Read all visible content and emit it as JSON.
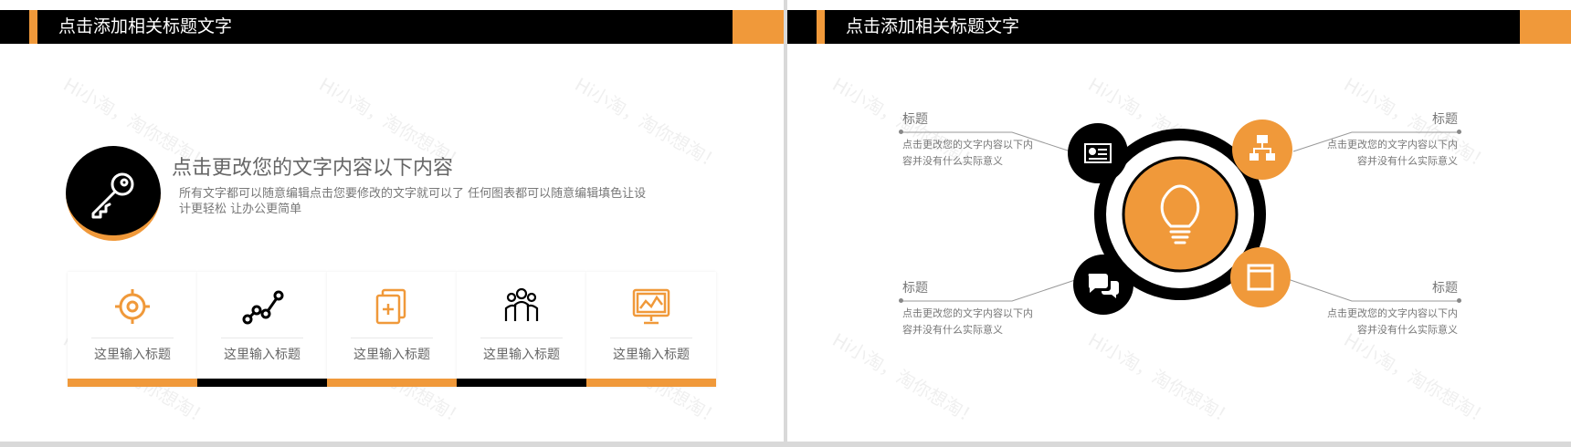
{
  "header_title": "点击添加相关标题文字",
  "watermark": "Hi小淘，淘你想淘！",
  "colors": {
    "accent": "#f0993a",
    "dark": "#000000",
    "text": "#666666"
  },
  "left_slide": {
    "heading": "点击更改您的文字内容以下内容",
    "description": "所有文字都可以随意编辑点击您要修改的文字就可以了 任何图表都可以随意编辑填色让设计更轻松 让办公更简单",
    "cards": [
      {
        "label": "这里输入标题",
        "icon": "target-icon",
        "bar": "accent"
      },
      {
        "label": "这里输入标题",
        "icon": "line-graph-icon",
        "bar": "dark"
      },
      {
        "label": "这里输入标题",
        "icon": "add-document-icon",
        "bar": "accent"
      },
      {
        "label": "这里输入标题",
        "icon": "people-group-icon",
        "bar": "dark"
      },
      {
        "label": "这里输入标题",
        "icon": "monitor-chart-icon",
        "bar": "accent"
      }
    ]
  },
  "right_slide": {
    "items": [
      {
        "title": "标题",
        "text": "点击更改您的文字内容以下内容并没有什么实际意义",
        "icon": "id-card-icon"
      },
      {
        "title": "标题",
        "text": "点击更改您的文字内容以下内容并没有什么实际意义",
        "icon": "network-icon"
      },
      {
        "title": "标题",
        "text": "点击更改您的文字内容以下内容并没有什么实际意义",
        "icon": "chat-icon"
      },
      {
        "title": "标题",
        "text": "点击更改您的文字内容以下内容并没有什么实际意义",
        "icon": "window-icon"
      }
    ],
    "center_icon": "lightbulb-icon"
  }
}
